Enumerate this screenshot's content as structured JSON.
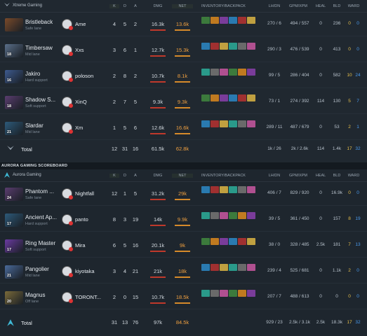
{
  "team1": {
    "name": "Xtreme Gaming",
    "columns": {
      "k": "K",
      "d": "D",
      "a": "A",
      "dmg": "DMG",
      "nt": "NET",
      "inv": "INVENTORY/BACKPACK",
      "lhdn": "LH/DN",
      "gpmxpm": "GPM/XPM",
      "heal": "HEAL",
      "bld": "BLD",
      "ward": "WARD"
    },
    "players": [
      {
        "hero": "Bristleback",
        "level": "",
        "role": "Safe lane",
        "player": "Ame",
        "k": "4",
        "d": "5",
        "a": "2",
        "dmg": "16.3k",
        "nt": "13.6k",
        "lhdn": "270 / 6",
        "gpmxpm": "494 / 557",
        "heal": "0",
        "bld": "236",
        "ward_a": "0",
        "ward_b": "0"
      },
      {
        "hero": "Timbersaw",
        "level": "18",
        "role": "Mid lane",
        "player": "Xxs",
        "k": "3",
        "d": "6",
        "a": "1",
        "dmg": "12.7k",
        "nt": "15.3k",
        "lhdn": "290 / 3",
        "gpmxpm": "476 / 539",
        "heal": "0",
        "bld": "413",
        "ward_a": "0",
        "ward_b": "0"
      },
      {
        "hero": "Jakiro",
        "level": "16",
        "role": "Hard support",
        "player": "poloson",
        "k": "2",
        "d": "8",
        "a": "2",
        "dmg": "10.7k",
        "nt": "8.1k",
        "lhdn": "99 / 5",
        "gpmxpm": "286 / 404",
        "heal": "0",
        "bld": "582",
        "ward_a": "10",
        "ward_b": "24"
      },
      {
        "hero": "Shadow S...",
        "level": "18",
        "role": "Soft support",
        "player": "XinQ",
        "k": "2",
        "d": "7",
        "a": "5",
        "dmg": "9.3k",
        "nt": "9.3k",
        "lhdn": "73 / 1",
        "gpmxpm": "274 / 392",
        "heal": "114",
        "bld": "130",
        "ward_a": "5",
        "ward_b": "7"
      },
      {
        "hero": "Slardar",
        "level": "21",
        "role": "Mid lane",
        "player": "Xm",
        "k": "1",
        "d": "5",
        "a": "6",
        "dmg": "12.6k",
        "nt": "16.6k",
        "lhdn": "289 / 11",
        "gpmxpm": "487 / 679",
        "heal": "0",
        "bld": "53",
        "ward_a": "2",
        "ward_b": "1"
      }
    ],
    "total": {
      "label": "Total",
      "k": "12",
      "d": "31",
      "a": "16",
      "dmg": "61.5k",
      "nt": "62.8k",
      "lhdn": "1k / 26",
      "gpmxpm": "2k / 2.6k",
      "heal": "114",
      "bld": "1.4k",
      "ward_a": "17",
      "ward_b": "32"
    }
  },
  "team2": {
    "scoreboard_title": "AURORA GAMING SCOREBOARD",
    "name": "Aurora Gaming",
    "columns": {
      "k": "K",
      "d": "D",
      "a": "A",
      "dmg": "DMG",
      "nt": "NET",
      "inv": "INVENTORY/BACKPACK",
      "lhdn": "LH/DN",
      "gpmxpm": "GPM/XPM",
      "heal": "HEAL",
      "bld": "BLD",
      "ward": "WARD"
    },
    "players": [
      {
        "hero": "Phantom ...",
        "level": "24",
        "role": "Safe lane",
        "player": "Nightfall",
        "k": "12",
        "d": "1",
        "a": "5",
        "dmg": "31.2k",
        "nt": "29k",
        "lhdn": "406 / 7",
        "gpmxpm": "829 / 920",
        "heal": "0",
        "bld": "16.9k",
        "ward_a": "0",
        "ward_b": "0"
      },
      {
        "hero": "Ancient Ap...",
        "level": "17",
        "role": "Hard support",
        "player": "panto",
        "k": "8",
        "d": "3",
        "a": "19",
        "dmg": "14k",
        "nt": "9.9k",
        "lhdn": "39 / 5",
        "gpmxpm": "361 / 450",
        "heal": "0",
        "bld": "157",
        "ward_a": "8",
        "ward_b": "19"
      },
      {
        "hero": "Ring Master",
        "level": "17",
        "role": "Soft support",
        "player": "Mira",
        "k": "6",
        "d": "5",
        "a": "16",
        "dmg": "20.1k",
        "nt": "9k",
        "lhdn": "38 / 0",
        "gpmxpm": "328 / 485",
        "heal": "2.5k",
        "bld": "181",
        "ward_a": "7",
        "ward_b": "13"
      },
      {
        "hero": "Pangolier",
        "level": "21",
        "role": "Mid lane",
        "player": "kiyotaka",
        "k": "3",
        "d": "4",
        "a": "21",
        "dmg": "21k",
        "nt": "18k",
        "lhdn": "239 / 4",
        "gpmxpm": "525 / 681",
        "heal": "0",
        "bld": "1.1k",
        "ward_a": "2",
        "ward_b": "0"
      },
      {
        "hero": "Magnus",
        "level": "20",
        "role": "Off lane",
        "player": "TORONT...",
        "k": "2",
        "d": "0",
        "a": "15",
        "dmg": "10.7k",
        "nt": "18.5k",
        "lhdn": "207 / 7",
        "gpmxpm": "488 / 613",
        "heal": "0",
        "bld": "0",
        "ward_a": "0",
        "ward_b": "0"
      }
    ],
    "total": {
      "label": "Total",
      "k": "31",
      "d": "13",
      "a": "76",
      "dmg": "97k",
      "nt": "84.5k",
      "lhdn": "929 / 23",
      "gpmxpm": "2.5k / 3.1k",
      "heal": "2.5k",
      "bld": "18.3k",
      "ward_a": "17",
      "ward_b": "32"
    }
  },
  "colors": {
    "net_orange": "#f0a040",
    "net_green": "#9fd46b",
    "ward_a": "#e8c04a",
    "ward_b": "#4a9cf0"
  }
}
